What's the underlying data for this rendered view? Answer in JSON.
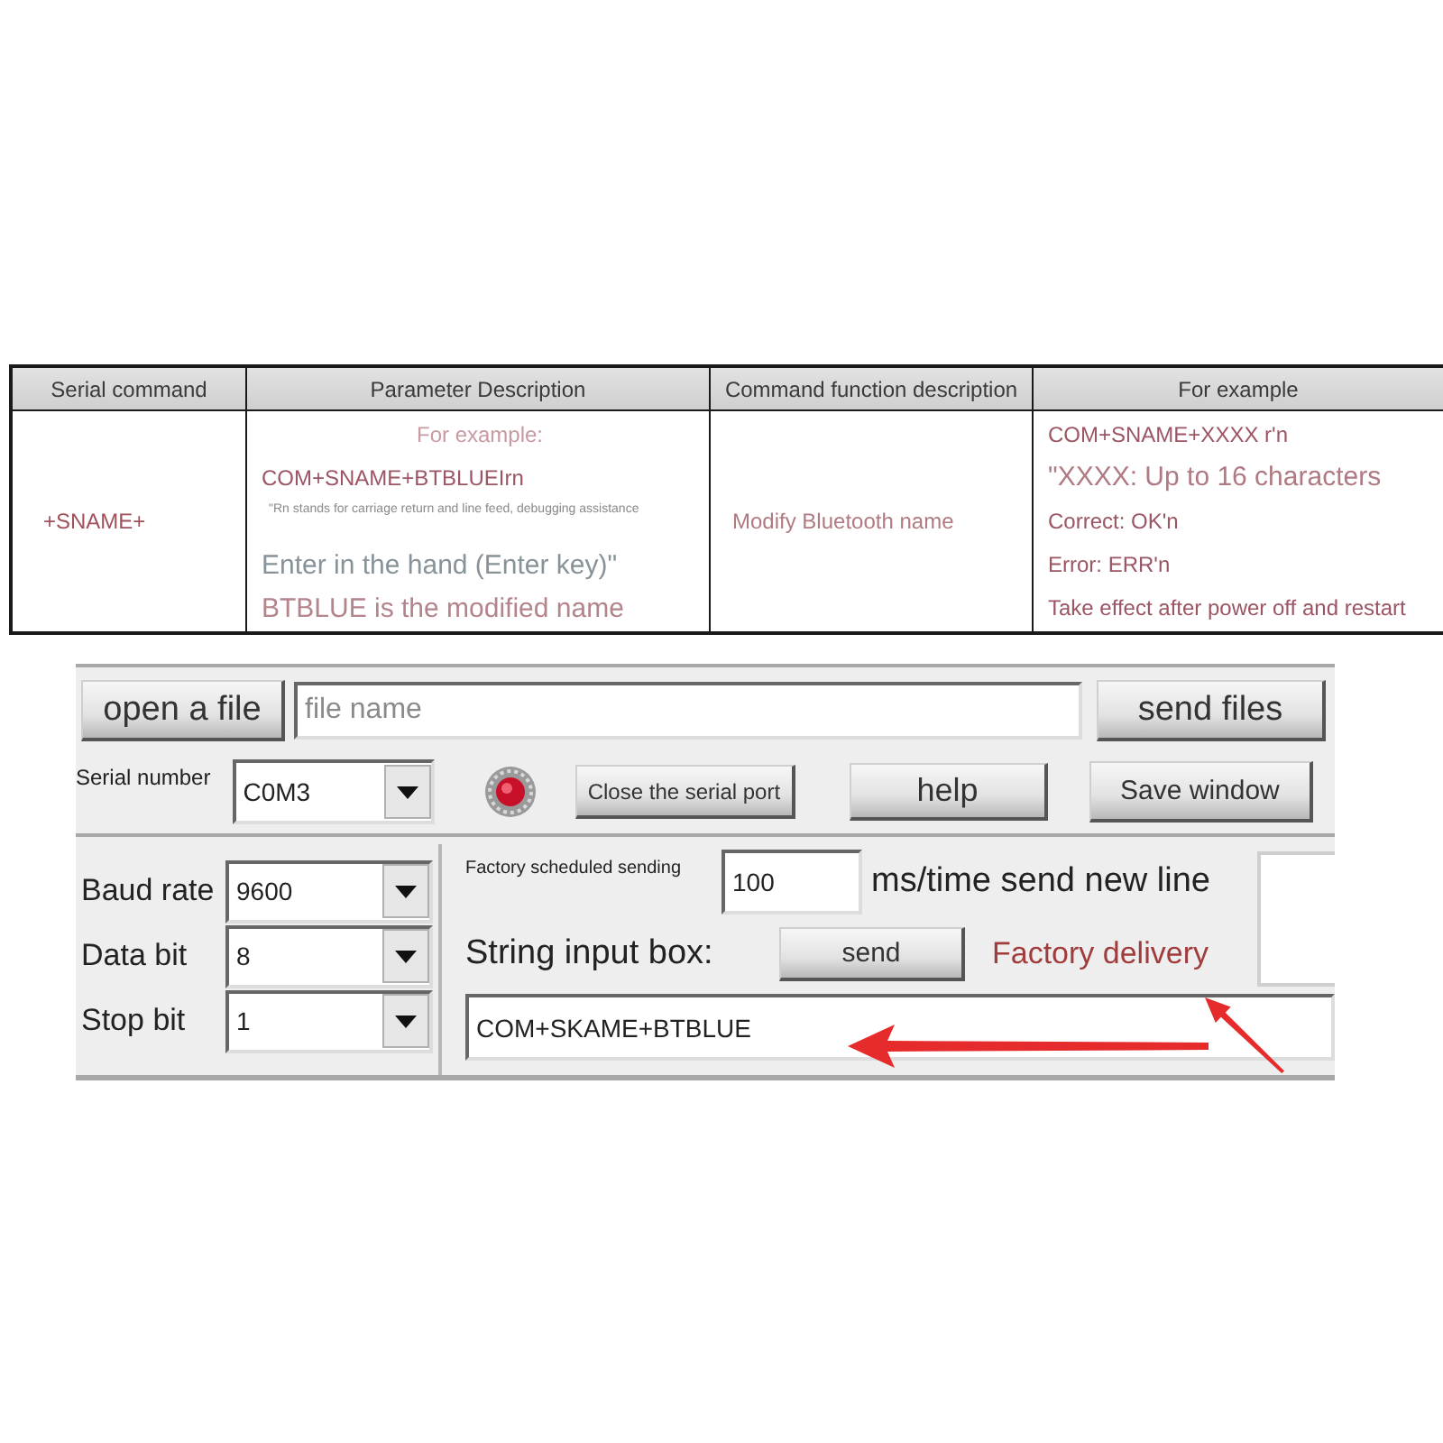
{
  "command_table": {
    "columns": [
      "Serial command",
      "Parameter Description",
      "Command function description",
      "For example"
    ],
    "rows": [
      {
        "serial_command": "+SNAME+",
        "parameter_description": [
          {
            "kind": "caption",
            "text": "For example:"
          },
          {
            "kind": "code",
            "text": "COM+SNAME+BTBLUEIrn"
          },
          {
            "kind": "footnote",
            "text": "\"Rn stands for carriage return and line feed, debugging assistance"
          },
          {
            "kind": "hint",
            "text": "Enter in the hand (Enter key)\""
          },
          {
            "kind": "remark",
            "text": "BTBLUE is the modified name"
          }
        ],
        "command_function": "Modify Bluetooth name",
        "for_example": [
          {
            "kind": "code",
            "text": "COM+SNAME+XXXX r'n"
          },
          {
            "kind": "heading",
            "text": "\"XXXX: Up to 16 characters"
          },
          {
            "kind": "code",
            "text": "Correct: OK'n"
          },
          {
            "kind": "code",
            "text": "Error: ERR'n"
          },
          {
            "kind": "code",
            "text": "Take effect after power off and restart"
          }
        ]
      }
    ]
  },
  "serial_tool": {
    "open_file_button": "open a file",
    "file_name_field": {
      "placeholder": "file name"
    },
    "send_files_button": "send files",
    "serial_number": {
      "label": "Serial number",
      "value": "C0M3"
    },
    "close_port_button": "Close the serial port",
    "help_button": "help",
    "save_window_button": "Save window",
    "settings": [
      {
        "label": "Baud rate",
        "value": "9600"
      },
      {
        "label": "Data bit",
        "value": "8"
      },
      {
        "label": "Stop bit",
        "value": "1"
      }
    ],
    "scheduled_sending": {
      "label": "Factory scheduled sending",
      "value": "100",
      "unit": "ms/time send new line"
    },
    "string_input": {
      "label": "String input box:",
      "send_button": "send",
      "note": "Factory delivery",
      "value": "COM+SKAME+BTBLUE"
    }
  }
}
